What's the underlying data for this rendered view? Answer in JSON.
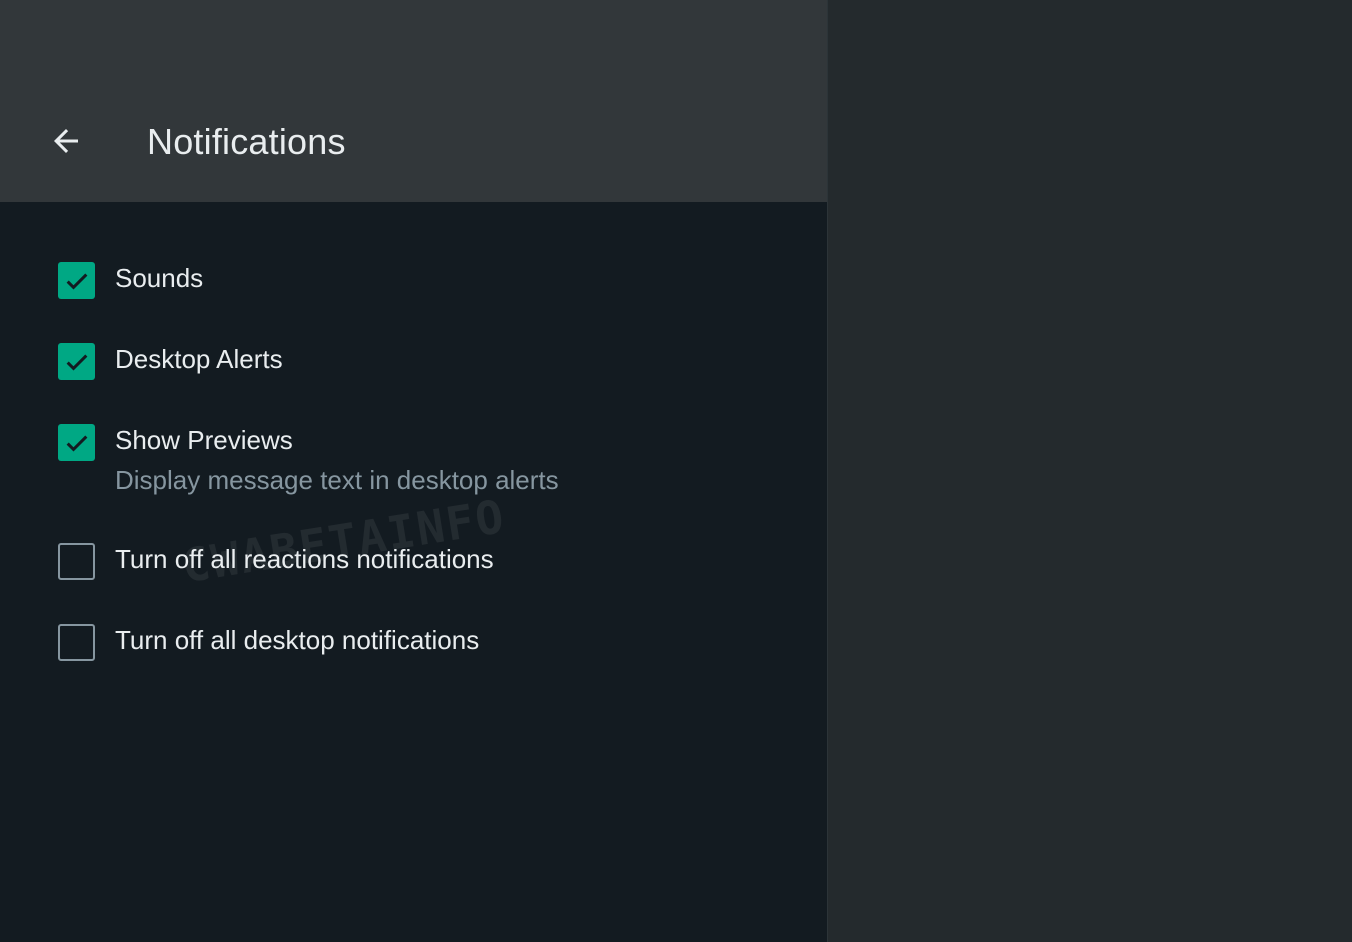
{
  "header": {
    "back_icon": "arrow-left-icon",
    "title": "Notifications"
  },
  "settings": [
    {
      "label": "Sounds",
      "checked": true,
      "subtitle": ""
    },
    {
      "label": "Desktop Alerts",
      "checked": true,
      "subtitle": ""
    },
    {
      "label": "Show Previews",
      "checked": true,
      "subtitle": "Display message text in desktop alerts"
    },
    {
      "label": "Turn off all reactions notifications",
      "checked": false,
      "subtitle": ""
    },
    {
      "label": "Turn off all desktop notifications",
      "checked": false,
      "subtitle": ""
    }
  ],
  "watermark": "CWABETAINFO",
  "colors": {
    "accent": "#00a884",
    "header_bg": "#32373a",
    "panel_bg": "#131b21",
    "right_bg": "#242a2d",
    "text_primary": "#e9edef",
    "text_secondary": "#8696a0"
  }
}
